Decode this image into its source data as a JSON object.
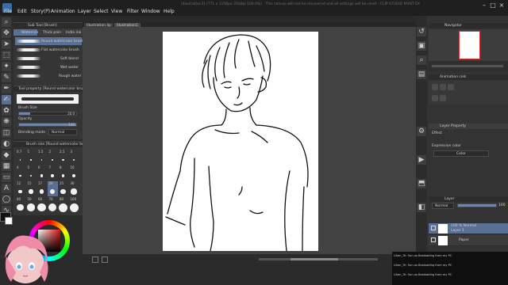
{
  "menu": {
    "items": [
      "File",
      "Edit",
      "Story(P)",
      "Animation",
      "Layer",
      "Select",
      "View",
      "Filter",
      "Window",
      "Help"
    ],
    "title": "[Illustration1] (771 x 1156px 350dpi 100.0%) - This canvas will not be recovered and all settings will be reset - CLIP STUDIO PAINT EX"
  },
  "doc_tabs": [
    "Illustration.lip",
    "Illustration1"
  ],
  "subtool": {
    "header": "Sub Tool [Brush]",
    "tabs": [
      "Watercolor",
      "Thick paint",
      "India ink"
    ],
    "brushes": [
      "Round watercolor brush",
      "Flat watercolor brush",
      "Soft blend",
      "Wet water",
      "Rough water"
    ]
  },
  "tool_property": {
    "header": "Tool property [Round watercolor brush]",
    "brush_size_label": "Brush Size",
    "brush_size_value": "20.0",
    "opacity_label": "Opacity",
    "opacity_value": "100",
    "blending_label": "Blending mode",
    "blending_value": "Normal"
  },
  "brush_size_panel": {
    "header": "Brush size [Round watercolor brush]",
    "sizes": [
      "0.7",
      "1",
      "1.5",
      "2",
      "2.5",
      "3",
      "4",
      "5",
      "6",
      "7",
      "8",
      "10",
      "12",
      "15",
      "17",
      "20",
      "25",
      "30",
      "40",
      "50",
      "60",
      "70",
      "80",
      "100"
    ]
  },
  "navigator": {
    "header": "Navigator"
  },
  "layer_property": {
    "header": "Layer Property",
    "effect_label": "Effect",
    "expression_label": "Expression color",
    "expression_value": "Color"
  },
  "animation_cels": {
    "header": "Animation cels"
  },
  "layer_panel": {
    "header": "Layer",
    "blend_mode": "Normal",
    "opacity": "100",
    "layers": [
      {
        "name": "100 % Normal",
        "sub": "Layer 1"
      },
      {
        "name": "Paper",
        "sub": ""
      }
    ]
  },
  "chat": [
    "Lilian_Tri: Sun.us Baoloading from my PC",
    "Lilian_Tri: Sun.us Baoloading from my PC",
    "Lilian_Tri: Sun.us Baoloading from my PC"
  ],
  "colors": {
    "panel_bg": "#353535",
    "accent": "#6f84a8",
    "paper": "#ffffff",
    "chat_bg": "#0f0f0f"
  }
}
